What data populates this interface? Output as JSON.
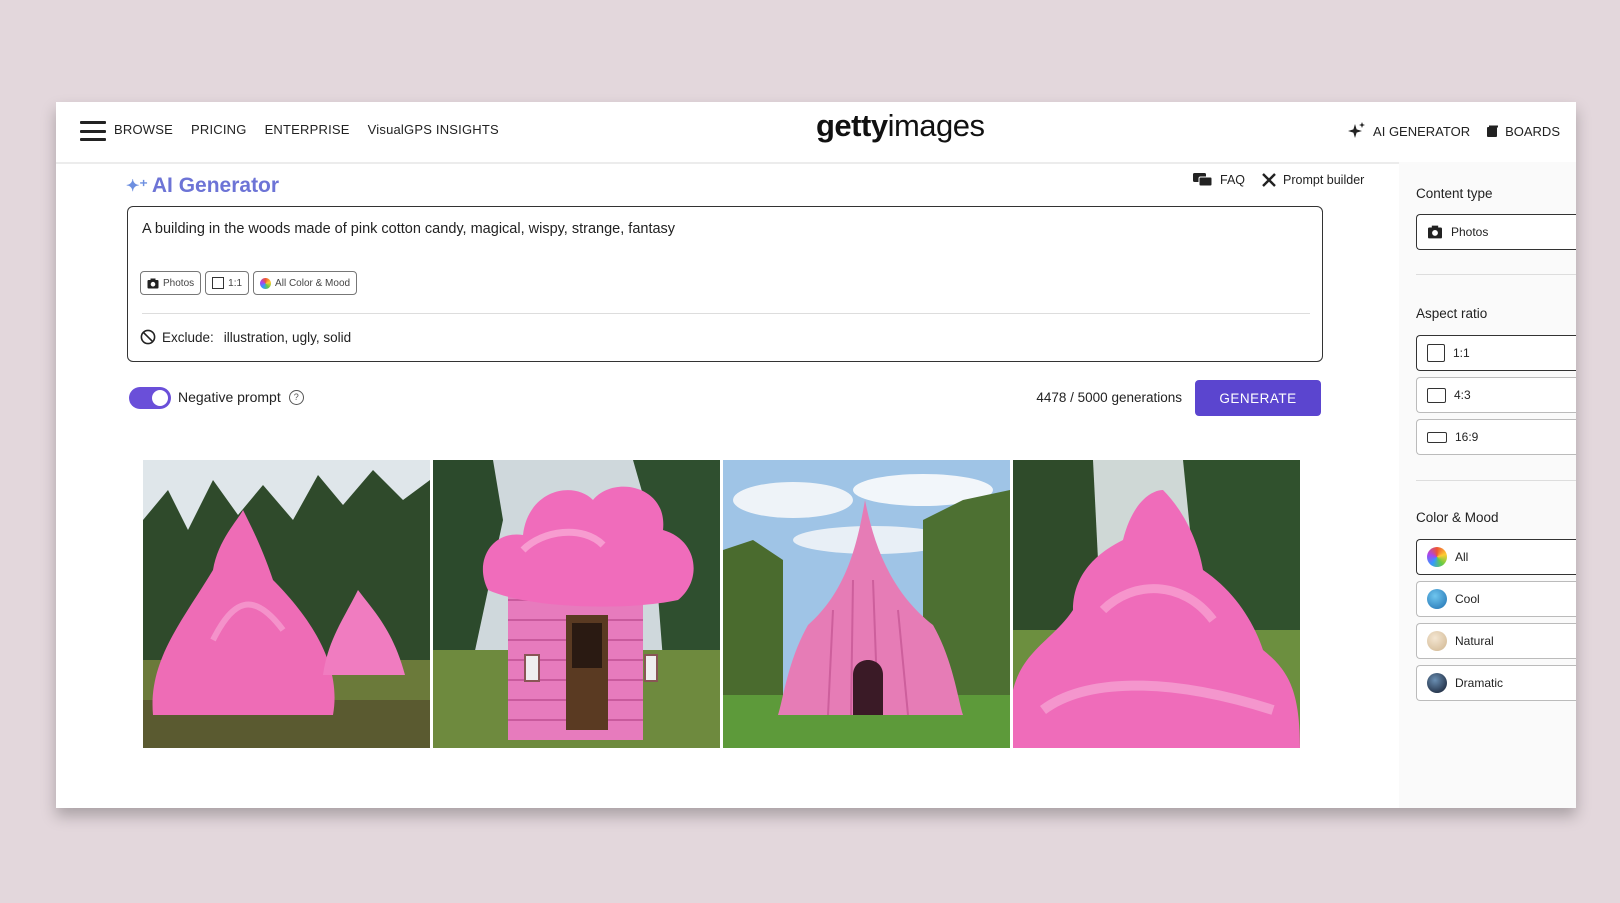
{
  "nav": {
    "links": [
      "BROWSE",
      "PRICING",
      "ENTERPRISE",
      "VisualGPS INSIGHTS"
    ],
    "logo_bold": "getty",
    "logo_light": "images",
    "ai_generator": "AI GENERATOR",
    "boards": "BOARDS"
  },
  "header": {
    "title": "AI Generator",
    "faq": "FAQ",
    "prompt_builder": "Prompt builder"
  },
  "prompt": {
    "text": "A building in the woods made of pink cotton candy, magical, wispy, strange, fantasy",
    "chips": [
      "Photos",
      "1:1",
      "All Color & Mood"
    ],
    "exclude_label": "Exclude:",
    "exclude_value": "illustration, ugly, solid"
  },
  "controls": {
    "negative_prompt": "Negative prompt",
    "negative_prompt_on": true,
    "help": "?",
    "generations": "4478 / 5000 generations",
    "generate": "GENERATE"
  },
  "panel": {
    "content_type_title": "Content type",
    "content_type": "Photos",
    "aspect_title": "Aspect ratio",
    "aspect": [
      "1:1",
      "4:3",
      "16:9"
    ],
    "color_title": "Color & Mood",
    "color": [
      "All",
      "Cool",
      "Natural",
      "Dramatic"
    ]
  },
  "colors": {
    "accent": "#5b45cf",
    "title": "#6d74d6",
    "cotton_candy": "#f06ab8"
  }
}
